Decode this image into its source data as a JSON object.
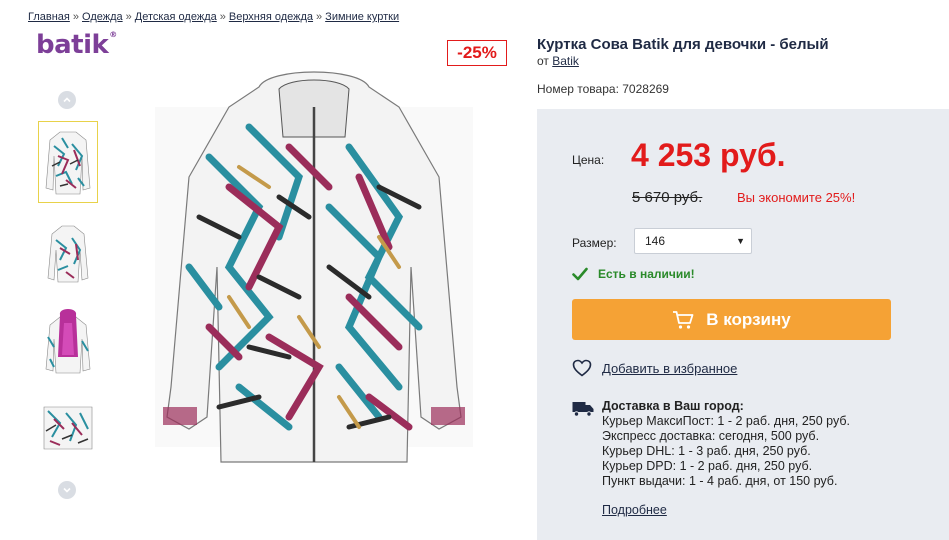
{
  "breadcrumb": {
    "items": [
      "Главная",
      "Одежда",
      "Детская одежда",
      "Верхняя одежда",
      "Зимние куртки"
    ],
    "separator": "»"
  },
  "brand_logo": {
    "text": "batik",
    "mark": "®"
  },
  "gallery": {
    "thumbnails": [
      "jacket-front",
      "jacket-back",
      "jacket-lining-open",
      "jacket-flat"
    ],
    "active_index": 0,
    "up_icon": "chevron-up-icon",
    "down_icon": "chevron-down-icon"
  },
  "discount_badge": "-25%",
  "product": {
    "title": "Куртка Сова Batik для девочки - белый",
    "brand_prefix": "от",
    "brand_name": "Batik",
    "sku_label": "Номер товара:",
    "sku_value": "7028269"
  },
  "price": {
    "label": "Цена:",
    "current": "4 253 руб.",
    "old": "5 670 руб.",
    "savings": "Вы экономите 25%!"
  },
  "size": {
    "label": "Размер:",
    "selected": "146"
  },
  "stock": {
    "text": "Есть в наличии!",
    "icon": "check-icon"
  },
  "cart_button": {
    "label": "В корзину",
    "icon": "cart-icon"
  },
  "favorites": {
    "label": "Добавить в избранное",
    "icon": "heart-icon"
  },
  "delivery": {
    "icon": "truck-icon",
    "heading": "Доставка в Ваш город:",
    "lines": [
      "Курьер МаксиПост: 1 - 2 раб. дня, 250 руб.",
      "Экспресс доставка: сегодня, 500 руб.",
      "Курьер DHL: 1 - 3 раб. дня, 250 руб.",
      "Курьер DPD: 1 - 2 раб. дня, 250 руб.",
      "Пункт выдачи: 1 - 4 раб. дня, от 150 руб."
    ],
    "more_link": "Подробнее"
  },
  "colors": {
    "price_red": "#e21b1b",
    "cart_orange": "#f5a235",
    "panel_bg": "#e9ecf1",
    "in_stock_green": "#2a8a2a",
    "brand_purple": "#7d3f98"
  }
}
